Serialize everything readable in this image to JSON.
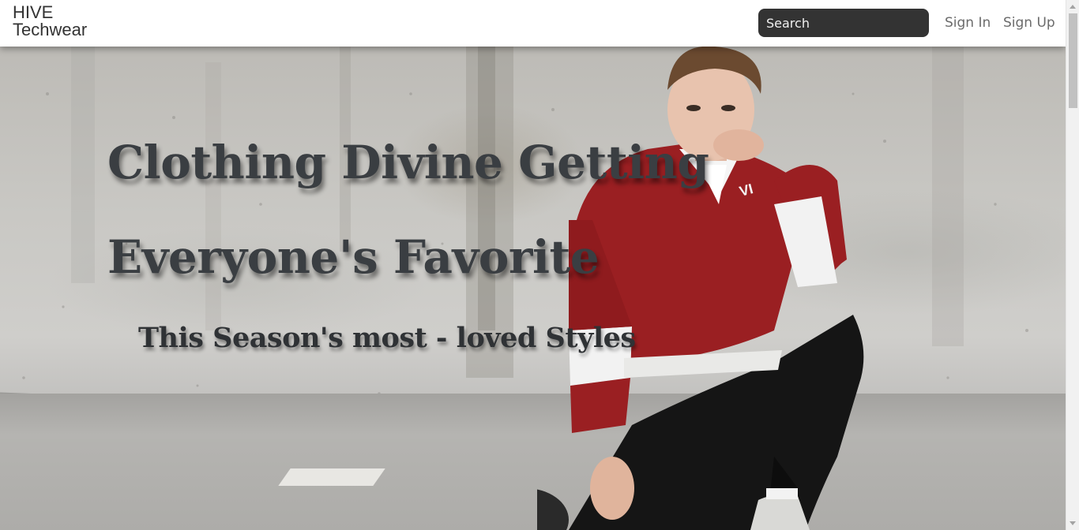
{
  "navbar": {
    "brand_line1": "HIVE",
    "brand_line2": "Techwear",
    "search_placeholder": "Search",
    "search_value": "",
    "signin_label": "Sign In",
    "signup_label": "Sign Up"
  },
  "hero": {
    "title_line1": "Clothing Divine Getting",
    "title_line2": "Everyone's Favorite",
    "subtitle": "This Season's most - loved Styles",
    "image_semantic": "model-sitting-against-concrete-wall"
  },
  "colors": {
    "search_bg": "#333333",
    "nav_link": "#6b6b6b",
    "hero_text": "#3a3e42",
    "jacket_red": "#9a1f22"
  }
}
